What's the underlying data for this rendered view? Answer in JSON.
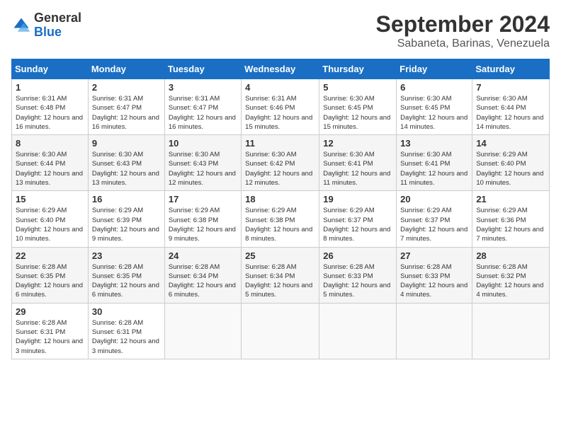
{
  "header": {
    "logo_general": "General",
    "logo_blue": "Blue",
    "month_year": "September 2024",
    "location": "Sabaneta, Barinas, Venezuela"
  },
  "weekdays": [
    "Sunday",
    "Monday",
    "Tuesday",
    "Wednesday",
    "Thursday",
    "Friday",
    "Saturday"
  ],
  "weeks": [
    [
      {
        "day": "1",
        "sunrise": "6:31 AM",
        "sunset": "6:48 PM",
        "daylight": "12 hours and 16 minutes."
      },
      {
        "day": "2",
        "sunrise": "6:31 AM",
        "sunset": "6:47 PM",
        "daylight": "12 hours and 16 minutes."
      },
      {
        "day": "3",
        "sunrise": "6:31 AM",
        "sunset": "6:47 PM",
        "daylight": "12 hours and 16 minutes."
      },
      {
        "day": "4",
        "sunrise": "6:31 AM",
        "sunset": "6:46 PM",
        "daylight": "12 hours and 15 minutes."
      },
      {
        "day": "5",
        "sunrise": "6:30 AM",
        "sunset": "6:45 PM",
        "daylight": "12 hours and 15 minutes."
      },
      {
        "day": "6",
        "sunrise": "6:30 AM",
        "sunset": "6:45 PM",
        "daylight": "12 hours and 14 minutes."
      },
      {
        "day": "7",
        "sunrise": "6:30 AM",
        "sunset": "6:44 PM",
        "daylight": "12 hours and 14 minutes."
      }
    ],
    [
      {
        "day": "8",
        "sunrise": "6:30 AM",
        "sunset": "6:44 PM",
        "daylight": "12 hours and 13 minutes."
      },
      {
        "day": "9",
        "sunrise": "6:30 AM",
        "sunset": "6:43 PM",
        "daylight": "12 hours and 13 minutes."
      },
      {
        "day": "10",
        "sunrise": "6:30 AM",
        "sunset": "6:43 PM",
        "daylight": "12 hours and 12 minutes."
      },
      {
        "day": "11",
        "sunrise": "6:30 AM",
        "sunset": "6:42 PM",
        "daylight": "12 hours and 12 minutes."
      },
      {
        "day": "12",
        "sunrise": "6:30 AM",
        "sunset": "6:41 PM",
        "daylight": "12 hours and 11 minutes."
      },
      {
        "day": "13",
        "sunrise": "6:30 AM",
        "sunset": "6:41 PM",
        "daylight": "12 hours and 11 minutes."
      },
      {
        "day": "14",
        "sunrise": "6:29 AM",
        "sunset": "6:40 PM",
        "daylight": "12 hours and 10 minutes."
      }
    ],
    [
      {
        "day": "15",
        "sunrise": "6:29 AM",
        "sunset": "6:40 PM",
        "daylight": "12 hours and 10 minutes."
      },
      {
        "day": "16",
        "sunrise": "6:29 AM",
        "sunset": "6:39 PM",
        "daylight": "12 hours and 9 minutes."
      },
      {
        "day": "17",
        "sunrise": "6:29 AM",
        "sunset": "6:38 PM",
        "daylight": "12 hours and 9 minutes."
      },
      {
        "day": "18",
        "sunrise": "6:29 AM",
        "sunset": "6:38 PM",
        "daylight": "12 hours and 8 minutes."
      },
      {
        "day": "19",
        "sunrise": "6:29 AM",
        "sunset": "6:37 PM",
        "daylight": "12 hours and 8 minutes."
      },
      {
        "day": "20",
        "sunrise": "6:29 AM",
        "sunset": "6:37 PM",
        "daylight": "12 hours and 7 minutes."
      },
      {
        "day": "21",
        "sunrise": "6:29 AM",
        "sunset": "6:36 PM",
        "daylight": "12 hours and 7 minutes."
      }
    ],
    [
      {
        "day": "22",
        "sunrise": "6:28 AM",
        "sunset": "6:35 PM",
        "daylight": "12 hours and 6 minutes."
      },
      {
        "day": "23",
        "sunrise": "6:28 AM",
        "sunset": "6:35 PM",
        "daylight": "12 hours and 6 minutes."
      },
      {
        "day": "24",
        "sunrise": "6:28 AM",
        "sunset": "6:34 PM",
        "daylight": "12 hours and 6 minutes."
      },
      {
        "day": "25",
        "sunrise": "6:28 AM",
        "sunset": "6:34 PM",
        "daylight": "12 hours and 5 minutes."
      },
      {
        "day": "26",
        "sunrise": "6:28 AM",
        "sunset": "6:33 PM",
        "daylight": "12 hours and 5 minutes."
      },
      {
        "day": "27",
        "sunrise": "6:28 AM",
        "sunset": "6:33 PM",
        "daylight": "12 hours and 4 minutes."
      },
      {
        "day": "28",
        "sunrise": "6:28 AM",
        "sunset": "6:32 PM",
        "daylight": "12 hours and 4 minutes."
      }
    ],
    [
      {
        "day": "29",
        "sunrise": "6:28 AM",
        "sunset": "6:31 PM",
        "daylight": "12 hours and 3 minutes."
      },
      {
        "day": "30",
        "sunrise": "6:28 AM",
        "sunset": "6:31 PM",
        "daylight": "12 hours and 3 minutes."
      },
      null,
      null,
      null,
      null,
      null
    ]
  ]
}
